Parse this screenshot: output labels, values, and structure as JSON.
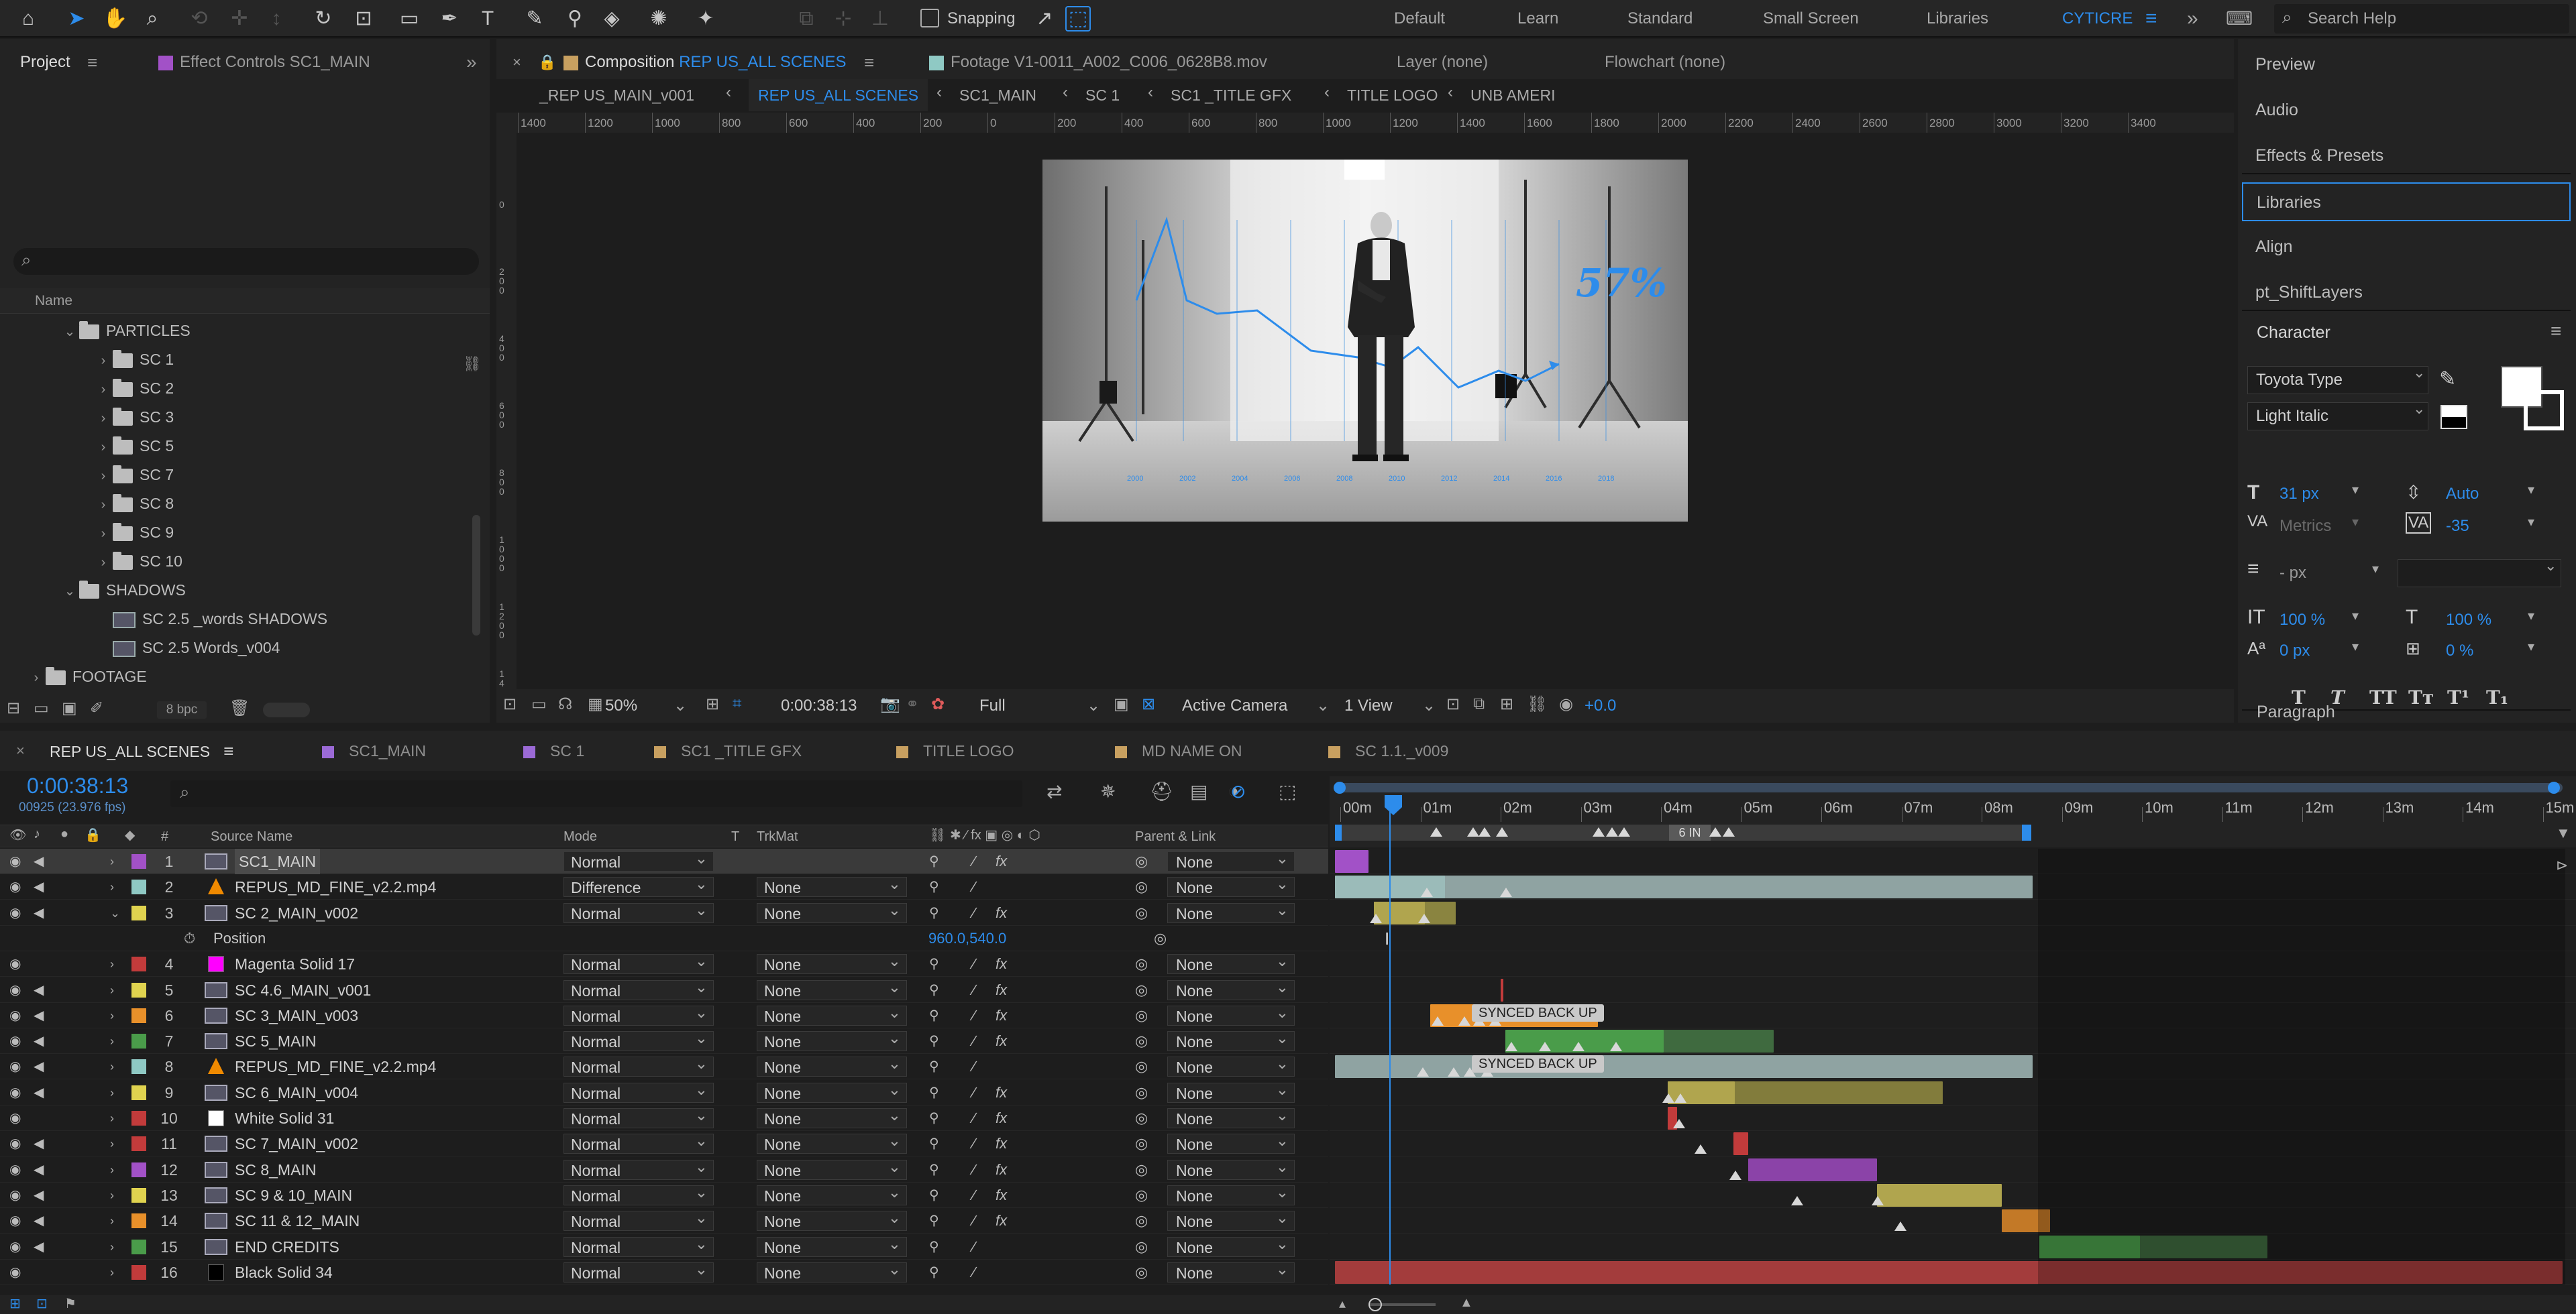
{
  "toolbar": {
    "snapping_label": "Snapping",
    "workspaces": [
      "Default",
      "Learn",
      "Standard",
      "Small Screen",
      "Libraries",
      "CYTICRE"
    ],
    "search_placeholder": "Search Help",
    "overflow": "»"
  },
  "project_panel": {
    "tab_project": "Project",
    "tab_effect_controls": "Effect Controls SC1_MAIN",
    "column_name": "Name",
    "bpc_label": "8 bpc",
    "tree": [
      {
        "label": "PARTICLES",
        "level": 1,
        "kind": "folder",
        "open": true
      },
      {
        "label": "SC 1",
        "level": 2,
        "kind": "folder"
      },
      {
        "label": "SC 2",
        "level": 2,
        "kind": "folder"
      },
      {
        "label": "SC 3",
        "level": 2,
        "kind": "folder"
      },
      {
        "label": "SC 5",
        "level": 2,
        "kind": "folder"
      },
      {
        "label": "SC 7",
        "level": 2,
        "kind": "folder"
      },
      {
        "label": "SC 8",
        "level": 2,
        "kind": "folder"
      },
      {
        "label": "SC 9",
        "level": 2,
        "kind": "folder"
      },
      {
        "label": "SC 10",
        "level": 2,
        "kind": "folder"
      },
      {
        "label": "SHADOWS",
        "level": 1,
        "kind": "folder",
        "open": true
      },
      {
        "label": "SC 2.5 _words SHADOWS",
        "level": 2,
        "kind": "comp"
      },
      {
        "label": "SC 2.5 Words_v004",
        "level": 2,
        "kind": "comp"
      },
      {
        "label": "FOOTAGE",
        "level": 0,
        "kind": "folder"
      }
    ]
  },
  "viewer": {
    "tab_composition_prefix": "Composition",
    "tab_composition_name": "REP US_ALL SCENES",
    "tab_footage": "Footage  V1-0011_A002_C006_0628B8.mov",
    "tab_layer": "Layer  (none)",
    "tab_flowchart": "Flowchart  (none)",
    "breadcrumbs": [
      "_REP US_MAIN_v001",
      "REP US_ALL SCENES",
      "SC1_MAIN",
      "SC 1",
      "SC1 _TITLE GFX",
      "TITLE LOGO",
      "UNB AMERI"
    ],
    "ruler_h": [
      "1400",
      "1200",
      "1000",
      "800",
      "600",
      "400",
      "200",
      "0",
      "200",
      "400",
      "600",
      "800",
      "1000",
      "1200",
      "1400",
      "1600",
      "1800",
      "2000",
      "2200",
      "2400",
      "2600",
      "2800",
      "3000",
      "3200",
      "3400"
    ],
    "ruler_v": [
      "0",
      "200",
      "400",
      "600",
      "800",
      "1000",
      "1200",
      "1400"
    ],
    "overlay_percent": "57%",
    "chart_years": [
      "2000",
      "2002",
      "2004",
      "2006",
      "2008",
      "2010",
      "2012",
      "2014",
      "2016",
      "2018"
    ],
    "zoom": "50%",
    "timecode": "0:00:38:13",
    "resolution": "Full",
    "camera": "Active Camera",
    "views": "1 View",
    "exposure": "+0.0"
  },
  "right_panel": {
    "items": [
      "Preview",
      "Audio",
      "Effects & Presets",
      "Libraries",
      "Align",
      "pt_ShiftLayers"
    ],
    "active_item": "Libraries",
    "character": {
      "title": "Character",
      "font": "Toyota Type",
      "style": "Light Italic",
      "size": "31 px",
      "leading": "Auto",
      "kerning": "Metrics",
      "tracking": "-35",
      "stroke": "- px",
      "vscale": "100 %",
      "hscale": "100 %",
      "baseline": "0 px",
      "tsume": "0 %",
      "styles": [
        "T",
        "T",
        "TT",
        "Tт",
        "T¹",
        "T₁"
      ],
      "fill_color": "#ffffff",
      "stroke_color": "#000000"
    },
    "paragraph_title": "Paragraph"
  },
  "timeline": {
    "tabs": [
      {
        "label": "REP US_ALL SCENES",
        "color": "#9b6ad6",
        "active": true
      },
      {
        "label": "SC1_MAIN",
        "color": "#9b6ad6"
      },
      {
        "label": "SC 1",
        "color": "#9b6ad6"
      },
      {
        "label": "SC1 _TITLE GFX",
        "color": "#c8a060"
      },
      {
        "label": "TITLE LOGO",
        "color": "#c8a060"
      },
      {
        "label": "MD NAME ON",
        "color": "#c8a060"
      },
      {
        "label": "SC 1.1._v009",
        "color": "#c8a060"
      }
    ],
    "current_time": "0:00:38:13",
    "frame_info": "00925 (23.976 fps)",
    "column_headers": {
      "num": "#",
      "source": "Source Name",
      "mode": "Mode",
      "t": "T",
      "trkmat": "TrkMat",
      "parent": "Parent & Link"
    },
    "ruler_labels": [
      "00m",
      "01m",
      "02m",
      "03m",
      "04m",
      "05m",
      "06m",
      "07m",
      "08m",
      "09m",
      "10m",
      "11m",
      "12m",
      "13m",
      "14m",
      "15m"
    ],
    "work_area_marker": "6 IN",
    "position_property": {
      "label": "Position",
      "value": "960.0,540.0"
    },
    "layers": [
      {
        "num": "1",
        "name": "SC1_MAIN",
        "color": "#a251c7",
        "src": "comp",
        "mode": "Normal",
        "trk": "",
        "parent": "None",
        "fx": true,
        "selected": true
      },
      {
        "num": "2",
        "name": "REPUS_MD_FINE_v2.2.mp4",
        "color": "#8fc9c4",
        "src": "video",
        "mode": "Difference",
        "trk": "None",
        "parent": "None",
        "fx": false
      },
      {
        "num": "3",
        "name": "SC 2_MAIN_v002",
        "color": "#e0d34f",
        "src": "comp",
        "mode": "Normal",
        "trk": "None",
        "parent": "None",
        "fx": true,
        "open": true
      },
      {
        "num": "4",
        "name": "Magenta Solid 17",
        "color": "#c23b3b",
        "src": "solid",
        "solid": "#ff00ff",
        "mode": "Normal",
        "trk": "None",
        "parent": "None",
        "fx": true
      },
      {
        "num": "5",
        "name": "SC 4.6_MAIN_v001",
        "color": "#e0d34f",
        "src": "comp",
        "mode": "Normal",
        "trk": "None",
        "parent": "None",
        "fx": true
      },
      {
        "num": "6",
        "name": "SC 3_MAIN_v003",
        "color": "#e8902a",
        "src": "comp",
        "mode": "Normal",
        "trk": "None",
        "parent": "None",
        "fx": true
      },
      {
        "num": "7",
        "name": "SC 5_MAIN",
        "color": "#4a9c4a",
        "src": "comp",
        "mode": "Normal",
        "trk": "None",
        "parent": "None",
        "fx": true
      },
      {
        "num": "8",
        "name": "REPUS_MD_FINE_v2.2.mp4",
        "color": "#8fc9c4",
        "src": "video",
        "mode": "Normal",
        "trk": "None",
        "parent": "None",
        "fx": false
      },
      {
        "num": "9",
        "name": "SC 6_MAIN_v004",
        "color": "#e0d34f",
        "src": "comp",
        "mode": "Normal",
        "trk": "None",
        "parent": "None",
        "fx": true
      },
      {
        "num": "10",
        "name": "White Solid 31",
        "color": "#c23b3b",
        "src": "solid",
        "solid": "#ffffff",
        "mode": "Normal",
        "trk": "None",
        "parent": "None",
        "fx": true
      },
      {
        "num": "11",
        "name": "SC 7_MAIN_v002",
        "color": "#c23b3b",
        "src": "comp",
        "mode": "Normal",
        "trk": "None",
        "parent": "None",
        "fx": true
      },
      {
        "num": "12",
        "name": "SC 8_MAIN",
        "color": "#a251c7",
        "src": "comp",
        "mode": "Normal",
        "trk": "None",
        "parent": "None",
        "fx": true
      },
      {
        "num": "13",
        "name": "SC 9 & 10_MAIN",
        "color": "#e0d34f",
        "src": "comp",
        "mode": "Normal",
        "trk": "None",
        "parent": "None",
        "fx": true
      },
      {
        "num": "14",
        "name": "SC 11 & 12_MAIN",
        "color": "#e8902a",
        "src": "comp",
        "mode": "Normal",
        "trk": "None",
        "parent": "None",
        "fx": true
      },
      {
        "num": "15",
        "name": "END CREDITS",
        "color": "#4a9c4a",
        "src": "comp",
        "mode": "Normal",
        "trk": "None",
        "parent": "None",
        "fx": false
      },
      {
        "num": "16",
        "name": "Black Solid 34",
        "color": "#c23b3b",
        "src": "solid",
        "solid": "#000000",
        "mode": "Normal",
        "trk": "None",
        "parent": "None",
        "fx": false
      }
    ],
    "marker_labels": [
      "SYNCED BACK UP",
      "SYNCED BACK UP"
    ]
  }
}
